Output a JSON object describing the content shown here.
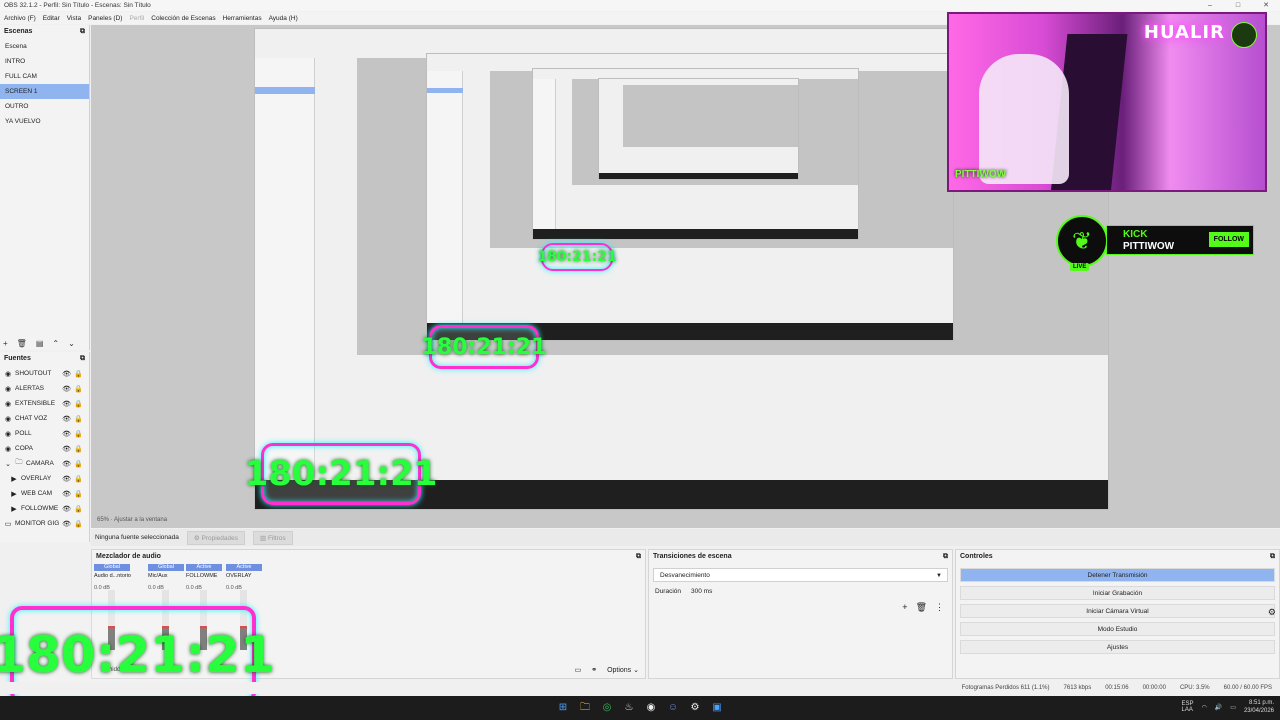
{
  "window": {
    "title": "OBS 32.1.2 - Perfil: Sin Título - Escenas: Sin Título",
    "minimize": "–",
    "maximize": "□",
    "close": "✕"
  },
  "menu": [
    "Archivo (F)",
    "Editar",
    "Vista",
    "Paneles (D)",
    "Perfil",
    "Colección de Escenas",
    "Herramientas",
    "Ayuda (H)"
  ],
  "scenes": {
    "title": "Escenas",
    "items": [
      "Escena",
      "INTRO",
      "FULL CAM",
      "SCREEN 1",
      "OUTRO",
      "YA VUELVO"
    ],
    "selected": "SCREEN 1"
  },
  "sources": {
    "title": "Fuentes",
    "items": [
      {
        "label": "SHOUTOUT",
        "icon": "scene-icon"
      },
      {
        "label": "ALERTAS",
        "icon": "scene-icon"
      },
      {
        "label": "EXTENSIBLE",
        "icon": "scene-icon"
      },
      {
        "label": "CHAT VOZ",
        "icon": "scene-icon"
      },
      {
        "label": "POLL",
        "icon": "scene-icon"
      },
      {
        "label": "COPA",
        "icon": "scene-icon"
      },
      {
        "label": "CAMARA",
        "icon": "folder-icon"
      },
      {
        "label": "OVERLAY",
        "icon": "play-icon"
      },
      {
        "label": "WEB CAM",
        "icon": "play-icon"
      },
      {
        "label": "FOLLOWME",
        "icon": "play-icon"
      },
      {
        "label": "MONITOR GIG",
        "icon": "monitor-icon"
      }
    ]
  },
  "preview": {
    "timer_text": "180:21:21",
    "kick": {
      "line1": "KICK",
      "line2": "PITTIWOW",
      "follow": "FOLLOW",
      "live": "LIVE"
    },
    "webcam_neon": "PITTIWOW",
    "webcam_sign": "HUALIR"
  },
  "zoom": {
    "value": "65%",
    "fit": "Ajustar a la ventana"
  },
  "propbar": {
    "none_selected": "Ninguna fuente seleccionada",
    "properties": "Propiedades",
    "filters": "Filtros"
  },
  "mixer": {
    "title": "Mezclador de audio",
    "channels": [
      {
        "badge": "Global",
        "name": "Audio d...ntorio",
        "db": "0.0 dB"
      },
      {
        "badge": "Global",
        "name": "Mic/Aux",
        "db": "0.0 dB"
      },
      {
        "badge": "Active",
        "name": "FOLLOWME",
        "db": "0.0 dB"
      },
      {
        "badge": "Active",
        "name": "OVERLAY",
        "db": "0.0 dB"
      }
    ],
    "hidden_label": "hidden",
    "options": "Options"
  },
  "transitions": {
    "title": "Transiciones de escena",
    "type": "Desvanecimiento",
    "duration_label": "Duración",
    "duration": "300 ms"
  },
  "controls": {
    "title": "Controles",
    "buttons": [
      "Detener Transmisión",
      "Iniciar Grabación",
      "Iniciar Cámara Virtual",
      "Modo Estudio",
      "Ajustes"
    ]
  },
  "status": {
    "frames": "Fotogramas Perdidos 611 (1.1%)",
    "bitrate": "7613 kbps",
    "live_time": "00:15:06",
    "rec_time": "00:00:00",
    "cpu": "CPU: 3.5%",
    "fps": "60.00 / 60.00 FPS"
  },
  "tray": {
    "lang": "ESP",
    "layout": "LAA",
    "time": "8:51 p.m.",
    "date": "23/04/2026"
  },
  "colors": {
    "accent": "#8fb4ef",
    "kick_green": "#53fc18",
    "timer_green": "#28ff3c",
    "timer_pink": "#ff2fd0"
  }
}
